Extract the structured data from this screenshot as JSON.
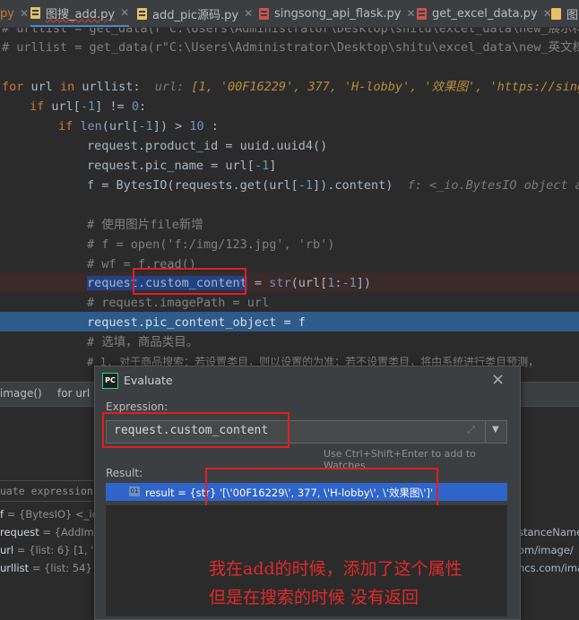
{
  "tabs": [
    {
      "label": "py"
    },
    {
      "label": "图搜_add.py"
    },
    {
      "label": "add_pic源码.py"
    },
    {
      "label": "singsong_api_flask.py"
    },
    {
      "label": "get_excel_data.py"
    },
    {
      "label": "图"
    }
  ],
  "code": {
    "l0": "# urllist = get_data(r\"C:\\Users\\Administrator\\Desktop\\shitu\\excel_data\\new_展示样.",
    "l1": "# urllist = get_data(r\"C:\\Users\\Administrator\\Desktop\\shitu\\excel_data\\new_英文档.",
    "l2_kw1": "for",
    "l2_a": " url ",
    "l2_kw2": "in",
    "l2_b": " urllist:  ",
    "l2_hint_label": "url:",
    "l2_hint_val": " [1, '00F16229', 377, 'H-lobby', '效果图', 'https://sings",
    "l3_kw": "if",
    "l3_a": " url[",
    "l3_n1": "-1",
    "l3_b": "] != ",
    "l3_n2": "0",
    "l3_c": ":",
    "l4_kw": "if",
    "l4_fn": " len",
    "l4_a": "(url[",
    "l4_n1": "-1",
    "l4_b": "]) > ",
    "l4_n2": "10",
    "l4_c": " :",
    "l5": "request.product_id = uuid.uuid4()",
    "l6_a": "request.pic_name = url[",
    "l6_n": "-1",
    "l6_b": "]",
    "l7_a": "f = BytesIO(requests.get(url[",
    "l7_n": "-1",
    "l7_b": "]).content)  ",
    "l7_hint": "f: <_io.BytesIO object a",
    "l9": "# 使用图片file新增",
    "l10": "# f = open('f:/img/123.jpg', 'rb')",
    "l11": "# wf = f.read()",
    "l12_a": "request.custom_content",
    "l12_b": " = ",
    "l12_fn": "str",
    "l12_c": "(url[",
    "l12_n1": "1",
    "l12_d": ":",
    "l12_n2": "-1",
    "l12_e": "])",
    "l13": "# request.imagePath = url",
    "l14": "request.pic_content_object = f",
    "l15": "# 选填，商品类目。",
    "l16": "# 1. 对于商品搜索：若设置类目，则以设置的为准；若不设置类目，将由系统进行类目预测，",
    "l17": "                                                                          。。。"
  },
  "debug": {
    "frames_tab": "image()",
    "frames_tab2": "for url",
    "eval_placeholder": "uate expression",
    "vars": [
      {
        "name": "f",
        "rest": "= {BytesIO} <_io"
      },
      {
        "name": "request",
        "rest": "= {AddIm"
      },
      {
        "name": "url",
        "rest": "= {list: 6} [1, '0"
      },
      {
        "name": "urllist",
        "rest": "= {list: 54} ["
      }
    ],
    "right_fragments": [
      "stanceName",
      "om/image/",
      "ncs.com/ima"
    ]
  },
  "dialog": {
    "title": "Evaluate",
    "logo": "PC",
    "close": "×",
    "expression_label": "Expression:",
    "expression_value": "request.custom_content",
    "watches_hint": "Use Ctrl+Shift+Enter to add to Watches",
    "result_label": "Result:",
    "result_badge": "01",
    "result_text": "result = {str} '[\\'00F16229\\', 377, \\'H-lobby\\', \\'效果图\\']'"
  },
  "annotation": {
    "line1": "我在add的时候，添加了这个属性",
    "line2": "但是在搜索的时候 没有返回"
  }
}
